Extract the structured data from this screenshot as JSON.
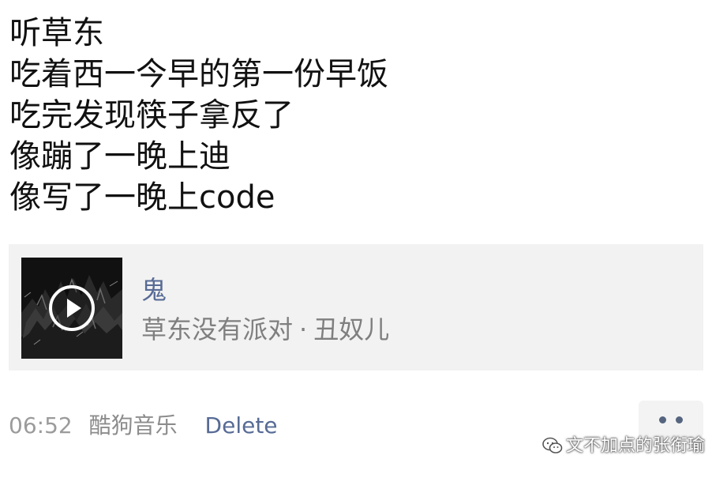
{
  "post": {
    "lines": [
      "听草东",
      "吃着西一今早的第一份早饭",
      "吃完发现筷子拿反了",
      "像蹦了一晚上迪",
      "像写了一晚上code"
    ]
  },
  "music_card": {
    "title": "鬼",
    "album": "草东没有派对",
    "separator": "·",
    "artist": "丑奴儿",
    "play_icon": "play-icon",
    "colors": {
      "title": "#576b95",
      "meta": "#7f7f7f",
      "card_bg": "#f2f2f2"
    }
  },
  "footer": {
    "time": "06:52",
    "source": "酷狗音乐",
    "delete_label": "Delete",
    "more_icon": "more-dots-icon"
  },
  "watermark": {
    "icon": "wechat-icon",
    "text": "文不加点的张衔瑜"
  },
  "colors": {
    "link": "#576b95",
    "text": "#111111"
  }
}
